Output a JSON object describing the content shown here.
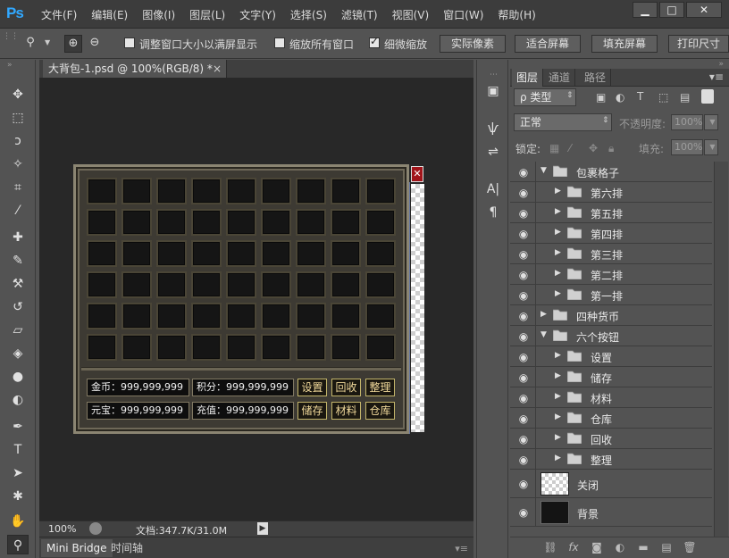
{
  "app": {
    "logo": "Ps",
    "menu": [
      "文件(F)",
      "编辑(E)",
      "图像(I)",
      "图层(L)",
      "文字(Y)",
      "选择(S)",
      "滤镜(T)",
      "视图(V)",
      "窗口(W)",
      "帮助(H)"
    ],
    "window_controls": {
      "minimize": "▁",
      "maximize": "□",
      "close": "✕"
    }
  },
  "options": {
    "resize_windows_label": "调整窗口大小以满屏显示",
    "resize_windows_checked": false,
    "zoom_all_label": "缩放所有窗口",
    "zoom_all_checked": false,
    "scrubby_label": "细微缩放",
    "scrubby_checked": true,
    "btn_actual": "实际像素",
    "btn_fit": "适合屏幕",
    "btn_fill": "填充屏幕",
    "btn_print": "打印尺寸"
  },
  "document": {
    "tab_title": "大背包-1.psd @ 100%(RGB/8) *",
    "tab_close": "×",
    "zoom": "100%",
    "doc_info": "文档:347.7K/31.0M"
  },
  "bottom_tabs": [
    "Mini Bridge",
    "时间轴"
  ],
  "game": {
    "rows": 6,
    "cols": 9,
    "close": "✕",
    "fields": [
      {
        "label": "金币：",
        "value": "999,999,999"
      },
      {
        "label": "积分：",
        "value": "999,999,999"
      },
      {
        "label": "元宝：",
        "value": "999,999,999"
      },
      {
        "label": "充值：",
        "value": "999,999,999"
      }
    ],
    "buttons_row1": [
      "设置",
      "回收",
      "整理"
    ],
    "buttons_row2": [
      "储存",
      "材料",
      "仓库"
    ]
  },
  "layers_panel": {
    "tabs": [
      "图层",
      "通道",
      "路径"
    ],
    "filter_type": "ρ 类型",
    "blend_mode": "正常",
    "opacity_label": "不透明度:",
    "opacity_value": "100%",
    "lock_label": "锁定:",
    "fill_label": "填充:",
    "fill_value": "100%",
    "layers": [
      {
        "name": "包裹格子",
        "level": 0,
        "type": "group",
        "open": true
      },
      {
        "name": "第六排",
        "level": 1,
        "type": "group",
        "open": false
      },
      {
        "name": "第五排",
        "level": 1,
        "type": "group",
        "open": false
      },
      {
        "name": "第四排",
        "level": 1,
        "type": "group",
        "open": false
      },
      {
        "name": "第三排",
        "level": 1,
        "type": "group",
        "open": false
      },
      {
        "name": "第二排",
        "level": 1,
        "type": "group",
        "open": false
      },
      {
        "name": "第一排",
        "level": 1,
        "type": "group",
        "open": false
      },
      {
        "name": "四种货币",
        "level": 0,
        "type": "group",
        "open": false
      },
      {
        "name": "六个按钮",
        "level": 0,
        "type": "group",
        "open": true
      },
      {
        "name": "设置",
        "level": 1,
        "type": "group",
        "open": false
      },
      {
        "name": "储存",
        "level": 1,
        "type": "group",
        "open": false
      },
      {
        "name": "材料",
        "level": 1,
        "type": "group",
        "open": false
      },
      {
        "name": "仓库",
        "level": 1,
        "type": "group",
        "open": false
      },
      {
        "name": "回收",
        "level": 1,
        "type": "group",
        "open": false
      },
      {
        "name": "整理",
        "level": 1,
        "type": "group",
        "open": false
      },
      {
        "name": "关闭",
        "level": 0,
        "type": "layer",
        "thumb": "transparent"
      },
      {
        "name": "背景",
        "level": 0,
        "type": "layer",
        "thumb": "background"
      }
    ]
  }
}
